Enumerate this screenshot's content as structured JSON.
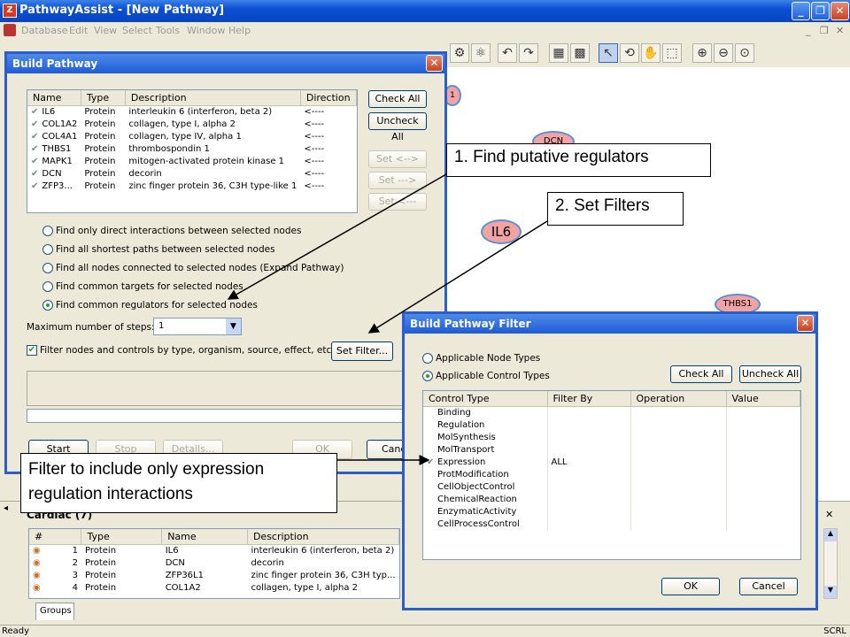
{
  "app": {
    "title": "PathwayAssist - [New Pathway]",
    "icon": "app-logo-icon"
  },
  "menu": [
    "Database",
    "Edit",
    "View",
    "Select",
    "Tools",
    "Window",
    "Help"
  ],
  "canvas_nodes": {
    "topleft": "1",
    "dcn": "DCN",
    "il6": "IL6",
    "thbs1": "THBS1"
  },
  "build_pathway": {
    "title": "Build Pathway",
    "columns": [
      "Name",
      "Type",
      "Description",
      "Direction"
    ],
    "rows": [
      [
        "IL6",
        "Protein",
        "interleukin 6 (interferon, beta 2)",
        "<----"
      ],
      [
        "COL1A2",
        "Protein",
        "collagen, type I, alpha 2",
        "<----"
      ],
      [
        "COL4A1",
        "Protein",
        "collagen, type IV, alpha 1",
        "<----"
      ],
      [
        "THBS1",
        "Protein",
        "thrombospondin 1",
        "<----"
      ],
      [
        "MAPK1",
        "Protein",
        "mitogen-activated protein kinase 1",
        "<----"
      ],
      [
        "DCN",
        "Protein",
        "decorin",
        "<----"
      ],
      [
        "ZFP3...",
        "Protein",
        "zinc finger protein 36, C3H type-like 1",
        "<----"
      ]
    ],
    "check_all": "Check All",
    "uncheck_all": "Uncheck All",
    "set_both": "Set <-->",
    "set_out": "Set --->",
    "set_in": "Set <---",
    "options": [
      "Find only direct interactions between selected nodes",
      "Find all shortest paths between selected nodes",
      "Find all nodes connected to selected nodes (Expand Pathway)",
      "Find common targets for selected nodes",
      "Find common regulators for selected nodes"
    ],
    "selected_option": 4,
    "max_steps_label": "Maximum number of steps:",
    "max_steps_value": "1",
    "filter_label": "Filter nodes and controls by type, organism, source, effect, etc.",
    "set_filter": "Set Filter...",
    "start": "Start",
    "stop": "Stop",
    "details": "Details...",
    "ok": "OK",
    "cancel": "Canc"
  },
  "filter_dialog": {
    "title": "Build Pathway Filter",
    "opt_nodes": "Applicable Node Types",
    "opt_controls": "Applicable Control Types",
    "check_all": "Check All",
    "uncheck_all": "Uncheck All",
    "columns": [
      "Control Type",
      "Filter By",
      "Operation",
      "Value"
    ],
    "rows": [
      [
        "Binding",
        ""
      ],
      [
        "Regulation",
        ""
      ],
      [
        "MolSynthesis",
        ""
      ],
      [
        "MolTransport",
        ""
      ],
      [
        "Expression",
        "ALL"
      ],
      [
        "ProtModification",
        ""
      ],
      [
        "CellObjectControl",
        ""
      ],
      [
        "ChemicalReaction",
        ""
      ],
      [
        "EnzymaticActivity",
        ""
      ],
      [
        "CellProcessControl",
        ""
      ]
    ],
    "checked_row": 4,
    "ok": "OK",
    "cancel": "Cancel"
  },
  "bottom_panel": {
    "title": "Cardiac (7)",
    "columns": [
      "#",
      "Type",
      "Name",
      "Description"
    ],
    "rows": [
      [
        "1",
        "Protein",
        "IL6",
        "interleukin 6 (interferon, beta 2)"
      ],
      [
        "2",
        "Protein",
        "DCN",
        "decorin"
      ],
      [
        "3",
        "Protein",
        "ZFP36L1",
        "zinc finger protein 36, C3H typ..."
      ],
      [
        "4",
        "Protein",
        "COL1A2",
        "collagen, type I, alpha 2"
      ]
    ],
    "tab": "Groups"
  },
  "callouts": {
    "c1": "1. Find putative regulators",
    "c2": "2. Set Filters",
    "c3": "Filter to include only expression regulation interactions"
  },
  "status": {
    "left": "Ready",
    "right": "SCRL"
  }
}
